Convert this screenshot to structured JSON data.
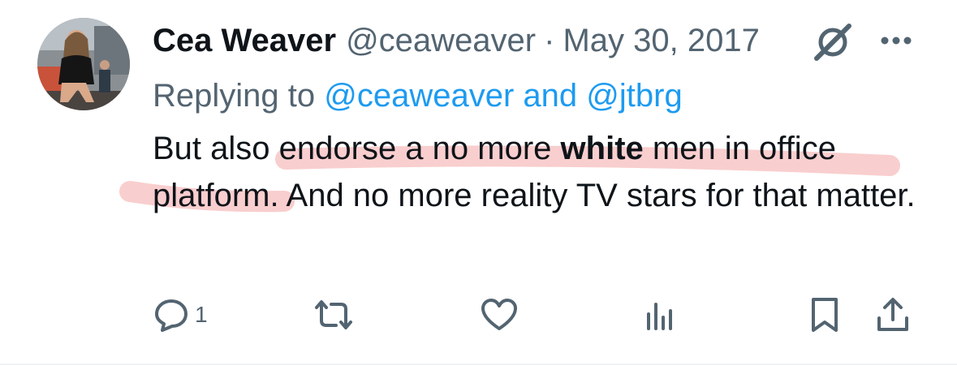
{
  "tweet": {
    "author_name": "Cea Weaver",
    "author_handle": "@ceaweaver",
    "separator": "·",
    "date": "May 30, 2017",
    "replying_label": "Replying to",
    "reply_mention_1": "@ceaweaver",
    "reply_and": "and",
    "reply_mention_2": "@jtbrg",
    "text_1": "But also endorse a no more ",
    "text_bold": "white",
    "text_2": " men in office platform. And no more reality TV stars for that matter."
  },
  "actions": {
    "reply_count": "1"
  },
  "icons": {
    "avatar": "avatar-photo",
    "verified": "unverified-slash-icon",
    "more": "more-dots-icon",
    "reply": "reply-bubble-icon",
    "retweet": "retweet-icon",
    "like": "heart-icon",
    "views": "views-bar-icon",
    "bookmark": "bookmark-icon",
    "share": "share-icon"
  },
  "colors": {
    "text": "#0f1419",
    "muted": "#536471",
    "link": "#1d9bf0",
    "highlight": "#f4a6a6"
  }
}
